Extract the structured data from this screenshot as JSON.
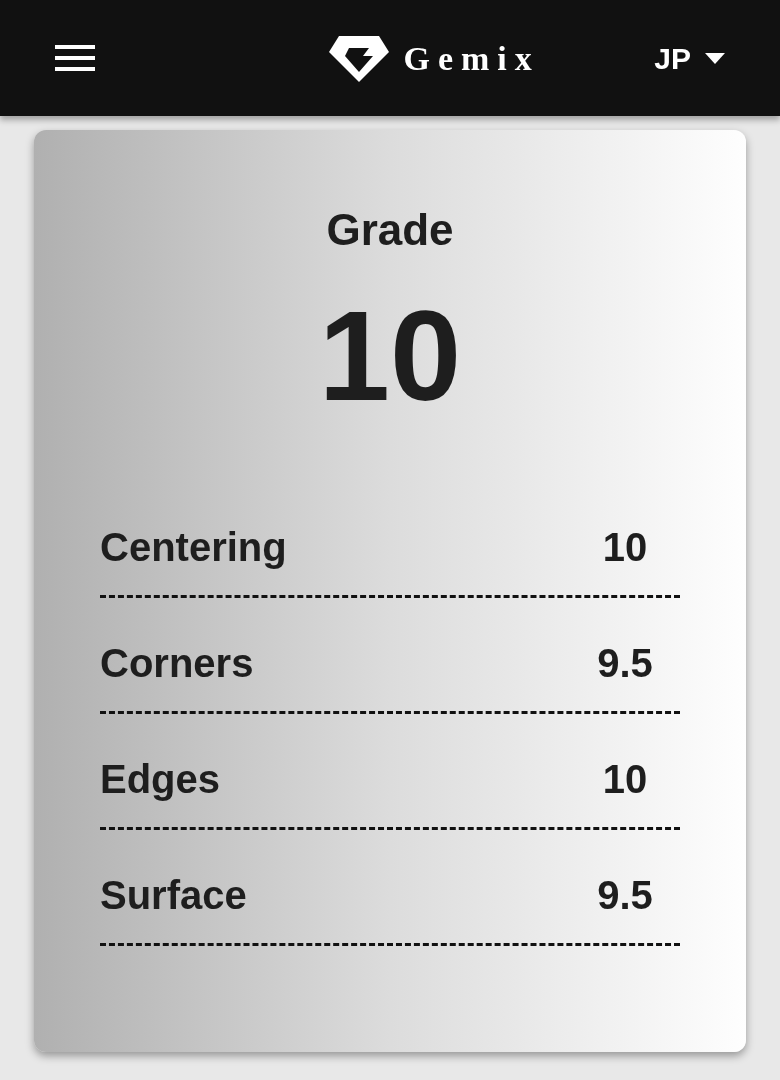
{
  "header": {
    "brand": "Gemix",
    "language": "JP"
  },
  "grade": {
    "title": "Grade",
    "value": "10"
  },
  "subgrades": [
    {
      "label": "Centering",
      "value": "10"
    },
    {
      "label": "Corners",
      "value": "9.5"
    },
    {
      "label": "Edges",
      "value": "10"
    },
    {
      "label": "Surface",
      "value": "9.5"
    }
  ]
}
